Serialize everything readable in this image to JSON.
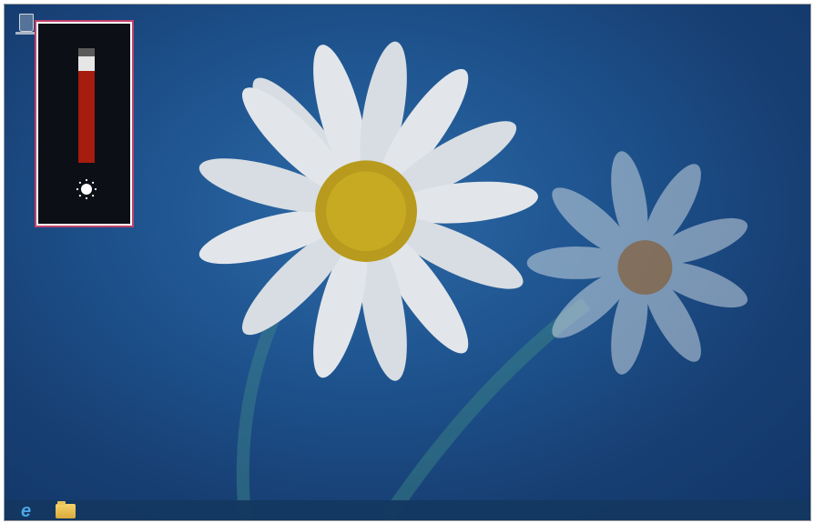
{
  "brightness": {
    "level": 0.8,
    "icon": "sun-icon",
    "fill_color": "#a61c0e",
    "track_color": "#5a5a5a",
    "thumb_color": "#e6e6e6",
    "highlight_border_color": "#c0426c"
  },
  "desktop": {
    "icons": [
      "recycle-bin-icon"
    ],
    "wallpaper": "daisy-flowers"
  },
  "taskbar": {
    "pinned": [
      "internet-explorer-icon",
      "file-explorer-icon"
    ]
  }
}
